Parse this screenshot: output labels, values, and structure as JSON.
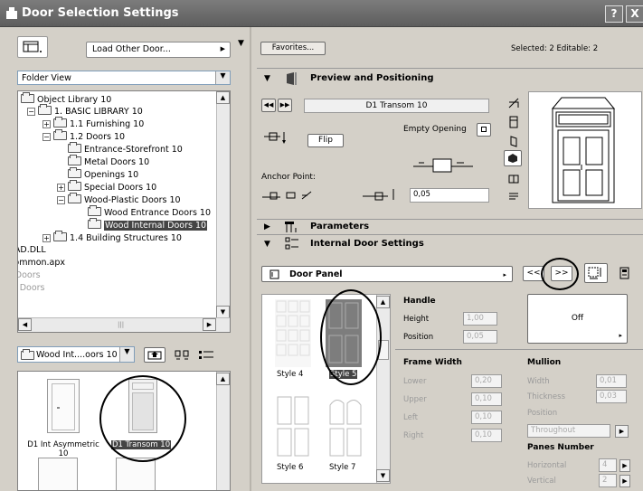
{
  "window": {
    "title": "Door Selection Settings",
    "help": "?",
    "close": "X"
  },
  "left": {
    "load_button": "Load Other Door...",
    "view_select": "Folder View",
    "tree": [
      {
        "label": "Object Library 10"
      },
      {
        "label": "1. BASIC LIBRARY 10"
      },
      {
        "label": "1.1 Furnishing 10"
      },
      {
        "label": "1.2 Doors 10"
      },
      {
        "label": "Entrance-Storefront 10"
      },
      {
        "label": "Metal Doors 10"
      },
      {
        "label": "Openings 10"
      },
      {
        "label": "Special Doors 10"
      },
      {
        "label": "Wood-Plastic Doors 10"
      },
      {
        "label": "Wood Entrance Doors 10"
      },
      {
        "label": "Wood Internal Doors 10"
      },
      {
        "label": "1.4 Building Structures 10"
      },
      {
        "label": "iiCAD.DLL"
      },
      {
        "label": "_Common.apx"
      },
      {
        "label": "er Doors"
      },
      {
        "label": "ing Doors"
      }
    ],
    "folder_select": "Wood Int....oors 10",
    "thumbnails": [
      {
        "label": "D1 Int Asymmetric\n10"
      },
      {
        "label": "D1 Transom 10"
      }
    ]
  },
  "right": {
    "favorites": "Favorites...",
    "selected_info": "Selected: 2 Editable: 2",
    "preview": {
      "section_title": "Preview and Positioning",
      "door_name": "D1 Transom 10",
      "empty_opening": "Empty Opening",
      "flip": "Flip",
      "anchor_point": "Anchor Point:",
      "anchor_value": "0,05"
    },
    "parameters_title": "Parameters",
    "internal_title": "Internal Door Settings",
    "panel_select": "Door Panel",
    "nav_prev": "<<",
    "nav_next": ">>",
    "styles": [
      {
        "label": "Style 4"
      },
      {
        "label": "Style 5"
      },
      {
        "label": "Style 6"
      },
      {
        "label": "Style 7"
      }
    ],
    "handle": {
      "title": "Handle",
      "height_label": "Height",
      "height_value": "1,00",
      "position_label": "Position",
      "position_value": "0,05",
      "button": "Off"
    },
    "frame": {
      "title": "Frame Width",
      "lower": "Lower",
      "lower_v": "0,20",
      "upper": "Upper",
      "upper_v": "0,10",
      "left": "Left",
      "left_v": "0,10",
      "right": "Right",
      "right_v": "0,10"
    },
    "mullion": {
      "title": "Mullion",
      "width": "Width",
      "width_v": "0,01",
      "thickness": "Thickness",
      "thickness_v": "0,03",
      "position": "Position",
      "position_select": "Throughout",
      "panes": "Panes Number",
      "horizontal": "Horizontal",
      "horizontal_v": "4",
      "vertical": "Vertical",
      "vertical_v": "2"
    }
  }
}
